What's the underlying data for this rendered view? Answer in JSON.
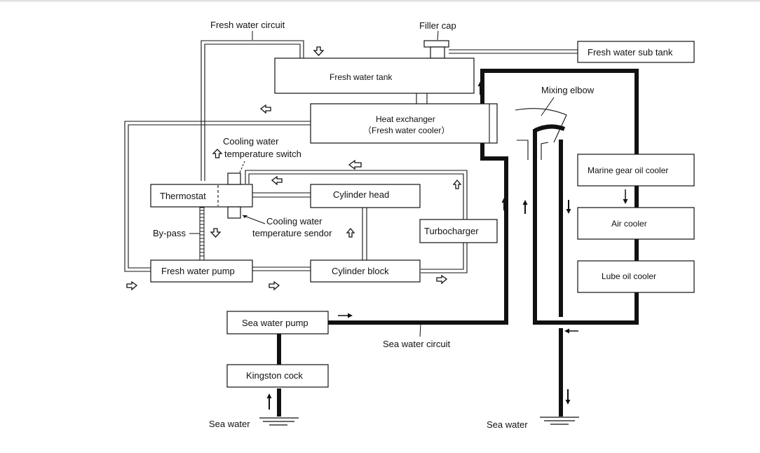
{
  "diagram": {
    "type": "marine engine cooling system schematic",
    "circuits": {
      "fresh_water": "Fresh water circuit",
      "sea_water": "Sea water circuit"
    },
    "components": {
      "filler_cap": "Filler cap",
      "fresh_water_sub_tank": "Fresh water sub tank",
      "fresh_water_tank": "Fresh water tank",
      "heat_exchanger_line1": "Heat exchanger",
      "heat_exchanger_line2": "（Fresh water cooler）",
      "mixing_elbow": "Mixing elbow",
      "thermostat": "Thermostat",
      "cylinder_head": "Cylinder head",
      "cylinder_block": "Cylinder block",
      "turbocharger": "Turbocharger",
      "fresh_water_pump": "Fresh water pump",
      "marine_gear_oil_cooler": "Marine gear oil cooler",
      "air_cooler": "Air cooler",
      "lube_oil_cooler": "Lube oil cooler",
      "sea_water_pump": "Sea water pump",
      "kingston_cock": "Kingston cock"
    },
    "annotations": {
      "temp_switch_line1": "Cooling water",
      "temp_switch_line2": "temperature switch",
      "temp_sensor_line1": "Cooling water",
      "temp_sensor_line2": "temperature sendor",
      "bypass": "By-pass",
      "sea_water_inlet": "Sea water",
      "sea_water_outlet": "Sea water"
    },
    "flow_arrows": {
      "fresh_water": "hollow",
      "sea_water": "solid"
    }
  }
}
